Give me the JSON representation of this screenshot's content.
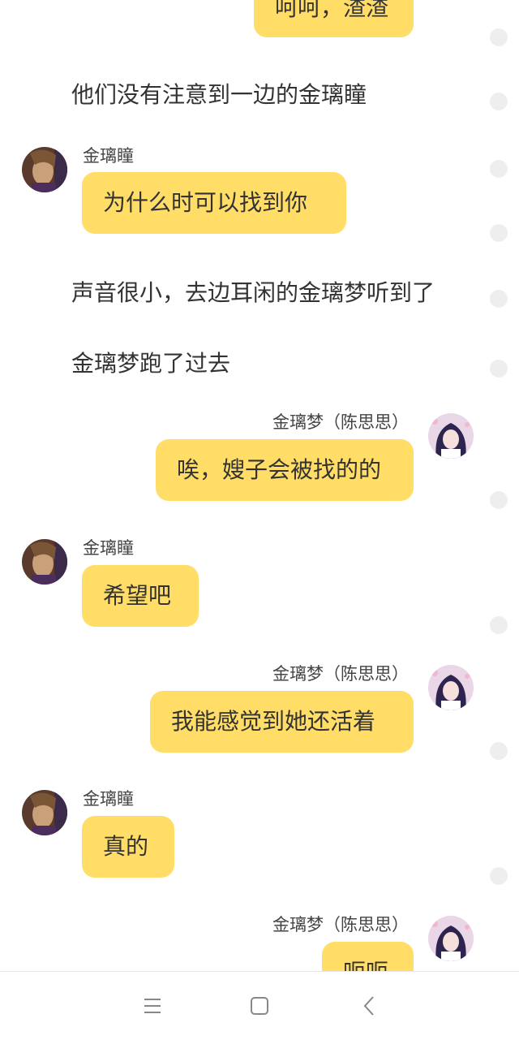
{
  "chat": {
    "messages": [
      {
        "type": "bubble_right",
        "sender": "",
        "text": "呵呵，渣渣"
      },
      {
        "type": "narration",
        "text": "他们没有注意到一边的金璃瞳"
      },
      {
        "type": "bubble_left",
        "sender": "金璃瞳",
        "text": "为什么时可以找到你"
      },
      {
        "type": "narration",
        "text": "声音很小，去边耳闲的金璃梦听到了"
      },
      {
        "type": "narration",
        "text": "金璃梦跑了过去"
      },
      {
        "type": "bubble_right",
        "sender": "金璃梦（陈思思）",
        "text": "唉，嫂子会被找的的"
      },
      {
        "type": "bubble_left",
        "sender": "金璃瞳",
        "text": "希望吧"
      },
      {
        "type": "bubble_right",
        "sender": "金璃梦（陈思思）",
        "text": "我能感觉到她还活着"
      },
      {
        "type": "bubble_left",
        "sender": "金璃瞳",
        "text": "真的"
      },
      {
        "type": "bubble_right",
        "sender": "金璃梦（陈思思）",
        "text": "呃呃"
      }
    ],
    "avatars": {
      "left_character": "male-character-avatar",
      "right_character": "anime-girl-avatar"
    },
    "colors": {
      "bubble": "#ffdd66",
      "text": "#333333",
      "dot": "#eeeeee",
      "background": "#ffffff"
    }
  },
  "navbar": {
    "buttons": [
      {
        "icon": "menu-icon"
      },
      {
        "icon": "home-square-icon"
      },
      {
        "icon": "back-chevron-icon"
      }
    ]
  }
}
